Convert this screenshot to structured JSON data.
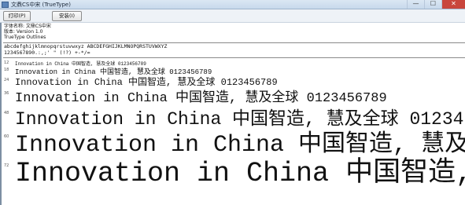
{
  "window": {
    "title": "文鼎CS中宋 (TrueType)",
    "minimize_label": "—",
    "maximize_label": "☐",
    "close_label": "✕"
  },
  "toolbar": {
    "print_label": "打印(P)",
    "install_label": "安装(I)"
  },
  "font_info": {
    "name_line": "字体名称: 文鼎CS中宋",
    "version_line": "版本: Version 1.0",
    "type_line": "TrueType Outlines"
  },
  "charset": {
    "line1": "abcdefghijklmnopqrstuvwxyz ABCDEFGHIJKLMNOPQRSTUVWXYZ",
    "line2": "1234567890.:,;' \" (!?) +-*/="
  },
  "samples": {
    "text": "Innovation in China 中国智造, 慧及全球 0123456789",
    "sizes": [
      "12",
      "18",
      "24",
      "36",
      "48",
      "60",
      "72"
    ]
  },
  "colors": {
    "titlebar": "#c7d9ec",
    "close_button": "#c9463d",
    "text": "#111111"
  }
}
